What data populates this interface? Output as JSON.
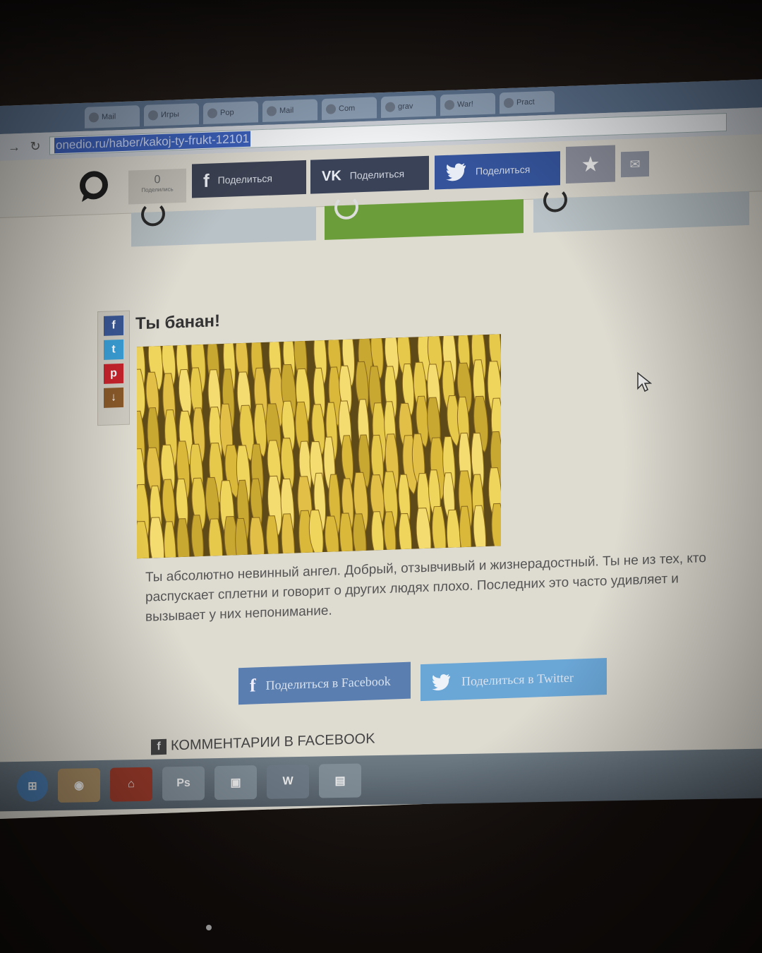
{
  "browser": {
    "tabs": [
      "Mail",
      "Игры",
      "Pop",
      "Mail",
      "Com",
      "grav",
      "War!",
      "Pract"
    ],
    "url": "onedio.ru/haber/kakoj-ty-frukt-12101"
  },
  "share_bar": {
    "count": "0",
    "count_label": "Поделились",
    "facebook_label": "Поделиться",
    "vk_label": "Поделиться",
    "twitter_label": "Поделиться"
  },
  "result": {
    "title": "Ты банан!",
    "description": "Ты абсолютно невинный ангел. Добрый, отзывчивый и жизнерадостный. Ты не из тех, кто распускает сплетни и говорит о других людях плохо. Последних это часто удивляет и вызывает у них непонимание."
  },
  "bottom_share": {
    "facebook_label": "Поделиться в Facebook",
    "twitter_label": "Поделиться в Twitter"
  },
  "comments": {
    "heading": "КОММЕНТАРИИ В FACEBOOK"
  },
  "colors": {
    "accent_green": "#6b9e3a",
    "facebook": "#3b5998",
    "twitter": "#3aa0d8"
  }
}
